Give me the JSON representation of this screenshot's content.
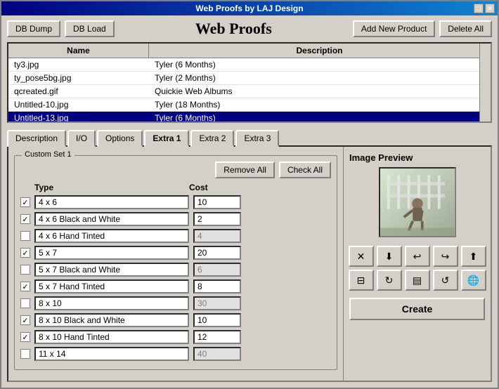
{
  "window": {
    "title": "Web Proofs by LAJ Design",
    "title_buttons": [
      "□",
      "✕"
    ]
  },
  "toolbar": {
    "db_dump_label": "DB Dump",
    "db_load_label": "DB Load",
    "app_title": "Web Proofs",
    "add_product_label": "Add New Product",
    "delete_all_label": "Delete All"
  },
  "table": {
    "headers": [
      "Name",
      "Description"
    ],
    "rows": [
      {
        "name": "ty3.jpg",
        "description": "Tyler (6 Months)",
        "selected": false
      },
      {
        "name": "ty_pose5bg.jpg",
        "description": "Tyler (2 Months)",
        "selected": false
      },
      {
        "name": "qcreated.gif",
        "description": "Quickie Web Albums",
        "selected": false
      },
      {
        "name": "Untitled-10.jpg",
        "description": "Tyler (18 Months)",
        "selected": false
      },
      {
        "name": "Untitled-13.jpg",
        "description": "Tyler (6 Months)",
        "selected": true
      }
    ]
  },
  "tabs": [
    {
      "label": "Description",
      "active": false
    },
    {
      "label": "I/O",
      "active": false
    },
    {
      "label": "Options",
      "active": false
    },
    {
      "label": "Extra 1",
      "active": true
    },
    {
      "label": "Extra 2",
      "active": false
    },
    {
      "label": "Extra 3",
      "active": false
    }
  ],
  "custom_set": {
    "label": "Custom Set 1",
    "remove_all": "Remove All",
    "check_all": "Check All",
    "type_header": "Type",
    "cost_header": "Cost",
    "products": [
      {
        "type": "4 x 6",
        "cost": "10",
        "checked": true
      },
      {
        "type": "4 x 6 Black and White",
        "cost": "2",
        "checked": true
      },
      {
        "type": "4 x 6 Hand Tinted",
        "cost": "4",
        "checked": false,
        "disabled": true
      },
      {
        "type": "5 x 7",
        "cost": "20",
        "checked": true
      },
      {
        "type": "5 x 7 Black and White",
        "cost": "6",
        "checked": false,
        "disabled": true
      },
      {
        "type": "5 x 7 Hand Tinted",
        "cost": "8",
        "checked": true
      },
      {
        "type": "8 x 10",
        "cost": "30",
        "checked": false,
        "disabled": true
      },
      {
        "type": "8 x 10 Black and White",
        "cost": "10",
        "checked": true
      },
      {
        "type": "8 x 10 Hand Tinted",
        "cost": "12",
        "checked": true
      },
      {
        "type": "11 x 14",
        "cost": "40",
        "checked": false,
        "disabled": true
      }
    ]
  },
  "image_preview": {
    "title": "Image Preview"
  },
  "icon_buttons": [
    {
      "name": "x-icon",
      "symbol": "✕"
    },
    {
      "name": "down-arrow-icon",
      "symbol": "⬇"
    },
    {
      "name": "left-arrow-icon",
      "symbol": "↩"
    },
    {
      "name": "right-arrow-icon",
      "symbol": "↪"
    },
    {
      "name": "up-arrow-icon",
      "symbol": "⬆"
    },
    {
      "name": "dash-icon",
      "symbol": "⊟"
    },
    {
      "name": "rotate-icon",
      "symbol": "↻"
    },
    {
      "name": "text-icon",
      "symbol": "▤"
    },
    {
      "name": "rotate2-icon",
      "symbol": "↺"
    },
    {
      "name": "globe-icon",
      "symbol": "🌐"
    }
  ],
  "create_button": "Create"
}
